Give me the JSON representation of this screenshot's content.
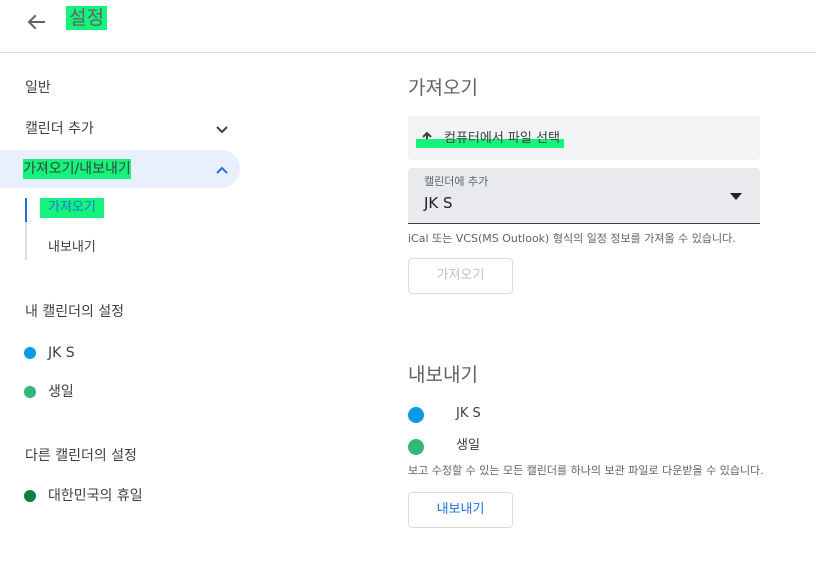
{
  "header": {
    "title": "설정",
    "back_icon": "arrow-left-icon"
  },
  "sidebar": {
    "general": "일반",
    "add_calendar": "캘린더 추가",
    "import_export": "가져오기/내보내기",
    "sub_items": [
      "가져오기",
      "내보내기"
    ],
    "my_calendars_title": "내 캘린더의 설정",
    "my_calendars": [
      {
        "label": "JK S",
        "color": "#039be5"
      },
      {
        "label": "생일",
        "color": "#33b679"
      }
    ],
    "other_calendars_title": "다른 캘린더의 설정",
    "other_calendars": [
      {
        "label": "대한민국의 휴일",
        "color": "#0b8043"
      }
    ]
  },
  "import": {
    "title": "가져오기",
    "upload_label": "컴퓨터에서 파일 선택",
    "select_label": "캘린더에 추가",
    "select_value": "JK S",
    "help": "iCal 또는 VCS(MS Outlook) 형식의 일정 정보를 가져올 수 있습니다.",
    "button": "가져오기"
  },
  "export": {
    "title": "내보내기",
    "calendars": [
      {
        "label": "JK S",
        "color": "#039be5"
      },
      {
        "label": "생일",
        "color": "#33b679"
      }
    ],
    "help": "보고 수정할 수 있는 모든 캘린더를 하나의 보관 파일로 다운받을 수 있습니다.",
    "button": "내보내기"
  },
  "colors": {
    "accent": "#1a73e8",
    "highlight": "#16f37a",
    "active_bg": "#e8f0fe"
  }
}
